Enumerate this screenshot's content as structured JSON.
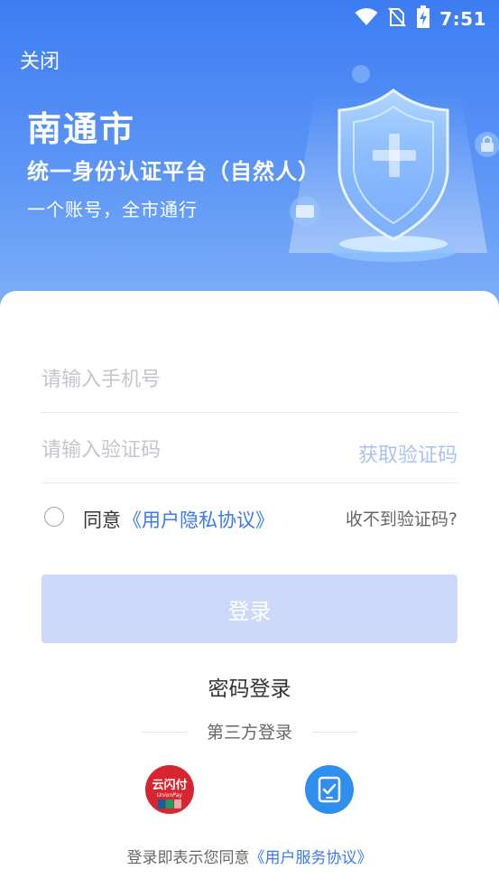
{
  "status_bar": {
    "time": "7:51",
    "icons": [
      "wifi-icon",
      "no-sim-icon",
      "battery-charging-icon"
    ]
  },
  "header": {
    "close_label": "关闭",
    "title": "南通市",
    "subtitle": "统一身份认证平台（自然人）",
    "slogan": "一个账号，全市通行",
    "art_icons": [
      "shield-icon",
      "lock-icon",
      "id-card-icon"
    ]
  },
  "form": {
    "phone_placeholder": "请输入手机号",
    "phone_value": "",
    "code_placeholder": "请输入验证码",
    "code_value": "",
    "get_code_label": "获取验证码",
    "agree_checked": false,
    "agree_label": "同意",
    "privacy_link": "《用户隐私协议》",
    "no_code_label": "收不到验证码?",
    "login_label": "登录",
    "password_login_label": "密码登录"
  },
  "third_party": {
    "label": "第三方登录",
    "providers": [
      {
        "icon": "unionpay-icon",
        "text": "云闪付",
        "subtext": "UnionPay"
      },
      {
        "icon": "tablet-check-icon"
      }
    ]
  },
  "footer": {
    "text": "登录即表示您同意",
    "link": "《用户服务协议》"
  },
  "colors": {
    "header_top": "#3d7df2",
    "accent": "#3a78f0",
    "login_disabled": "#cdd9fb",
    "unionpay_red": "#d7262f",
    "tablet_blue": "#2e8ff1"
  }
}
